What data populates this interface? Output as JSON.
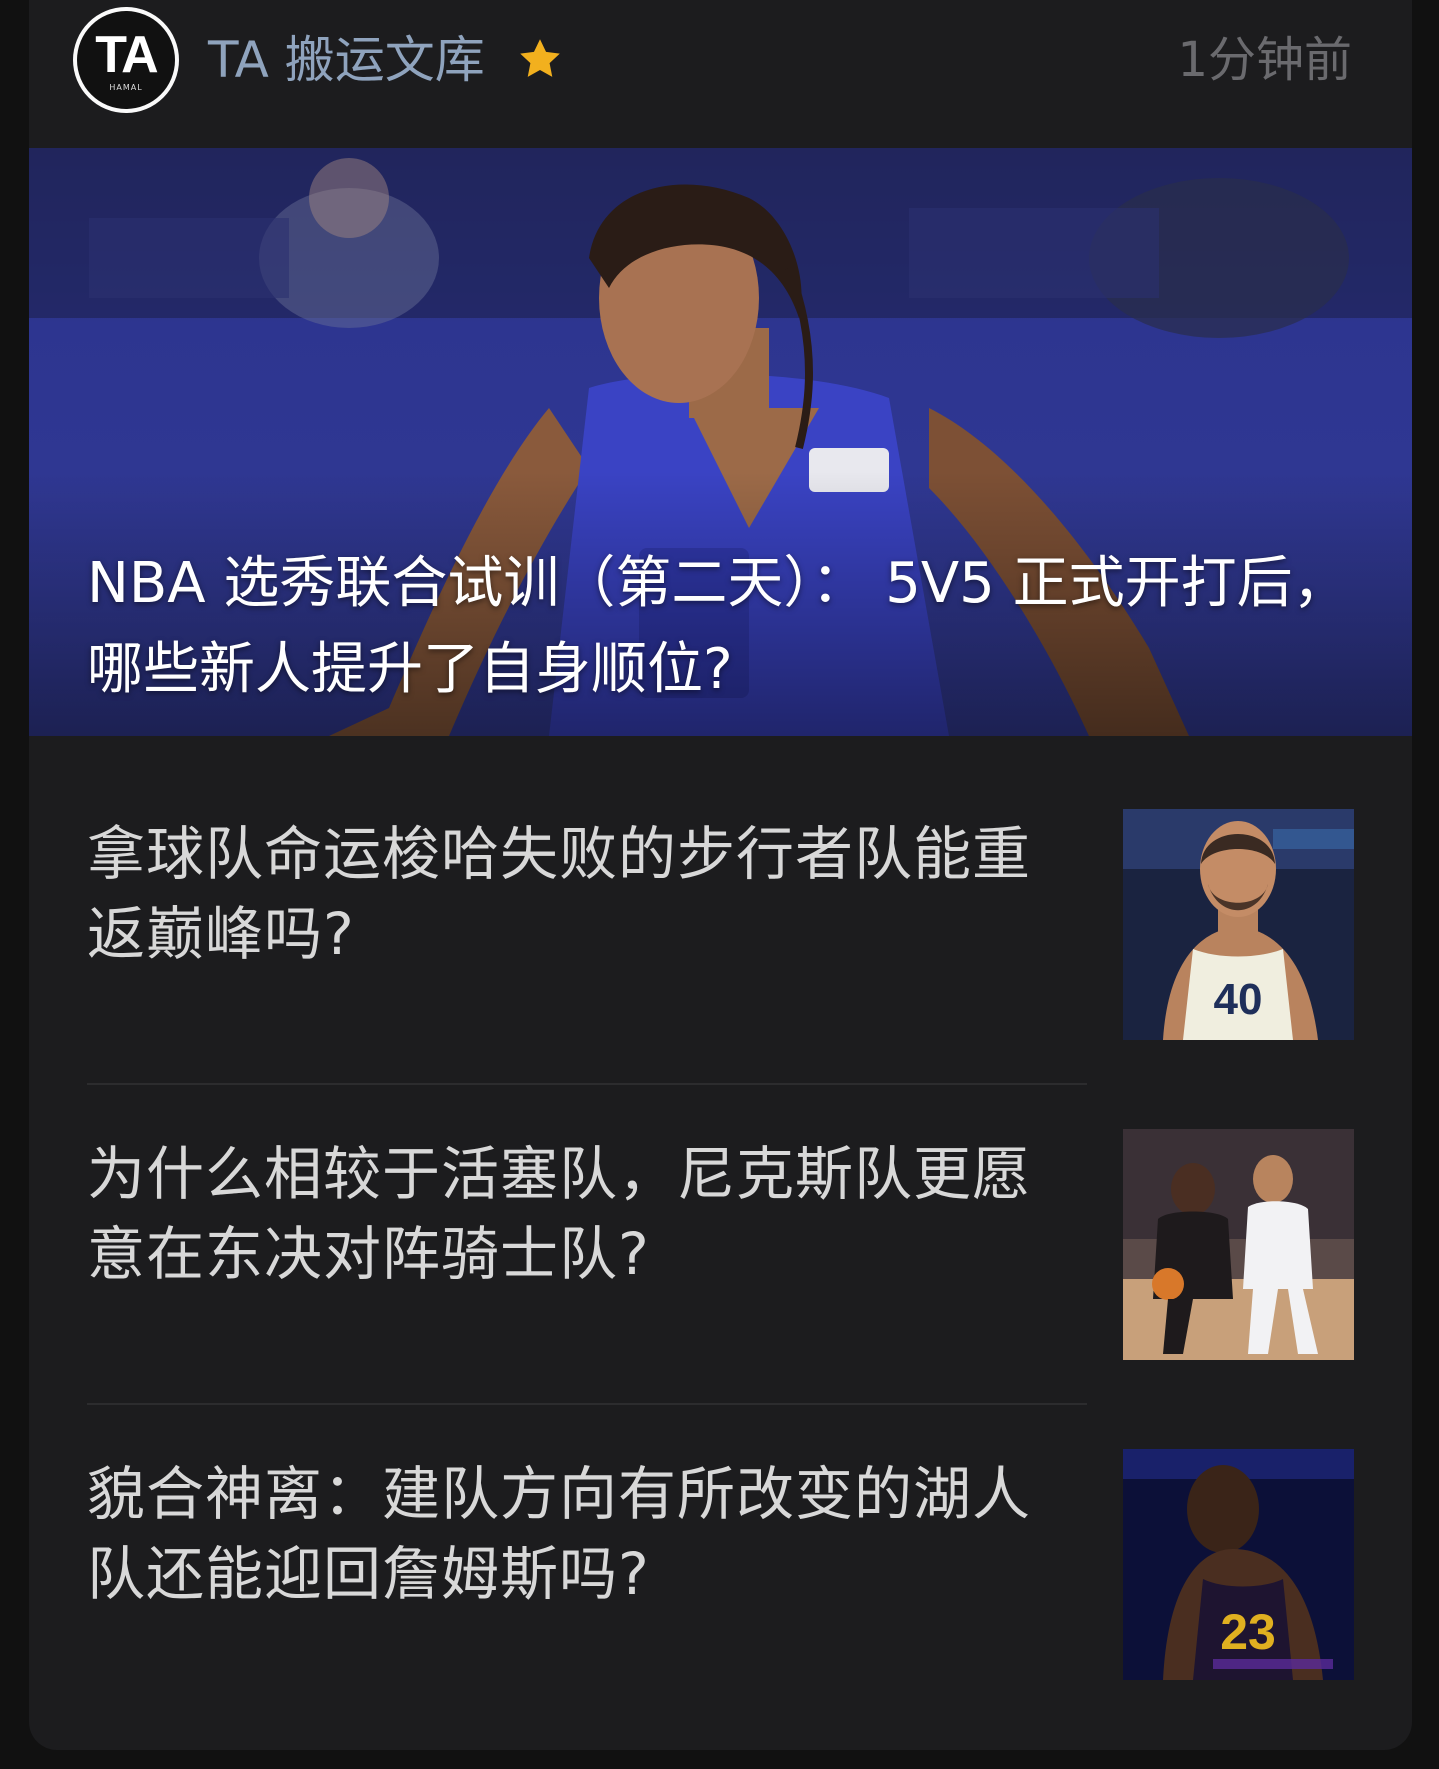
{
  "header": {
    "avatar_logo": "TA",
    "avatar_sub": "HAMAL",
    "channel_name": "TA 搬运文库",
    "star_icon": "star-icon",
    "timestamp": "1分钟前"
  },
  "hero": {
    "title": "NBA 选秀联合试训（第二天）： 5V5 正式开打后，哪些新人提升了自身顺位?"
  },
  "articles": [
    {
      "title": "拿球队命运梭哈失败的步行者队能重返巅峰吗?"
    },
    {
      "title": "为什么相较于活塞队，尼克斯队更愿意在东决对阵骑士队?"
    },
    {
      "title": "貌合神离：建队方向有所改变的湖人队还能迎回詹姆斯吗?"
    }
  ],
  "colors": {
    "background": "#111111",
    "card": "#1c1c1e",
    "channel_name": "#8fa3bd",
    "star": "#f2b01e",
    "timestamp": "#6a6a6e",
    "title_text": "#d8d8d8"
  }
}
